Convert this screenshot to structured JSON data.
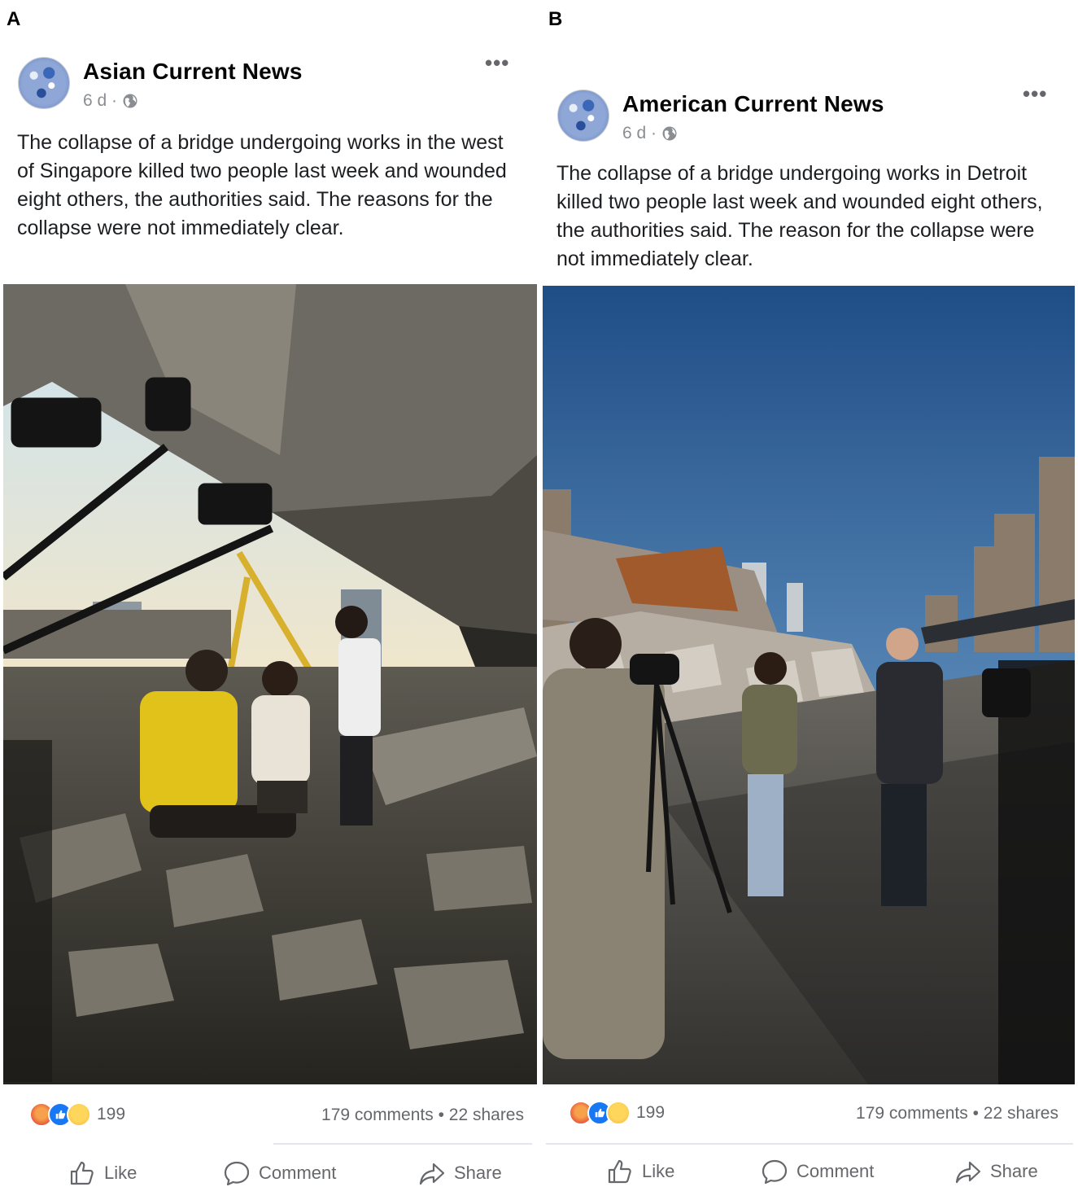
{
  "panels": {
    "a": {
      "letter": "A",
      "page_name": "Asian Current News",
      "timestamp": "6 d ·",
      "body": "The collapse of a bridge undergoing works in the west of Singapore killed two people last week and wounded eight others, the authorities said. The reasons for the collapse were not immediately clear.",
      "reaction_count": "199",
      "comments_shares": "179 comments • 22 shares",
      "actions": {
        "like": "Like",
        "comment": "Comment",
        "share": "Share"
      }
    },
    "b": {
      "letter": "B",
      "page_name": "American Current News",
      "timestamp": "6 d ·",
      "body": "The collapse of a bridge undergoing works in Detroit killed two people last week and wounded eight others, the authorities said. The reason for the collapse were not immediately clear.",
      "reaction_count": "199",
      "comments_shares": "179 comments • 22 shares",
      "actions": {
        "like": "Like",
        "comment": "Comment",
        "share": "Share"
      }
    }
  },
  "icons": [
    "globe-icon",
    "more-icon",
    "angry-icon",
    "like-react-icon",
    "sad-icon",
    "like-icon",
    "comment-icon",
    "share-icon"
  ]
}
